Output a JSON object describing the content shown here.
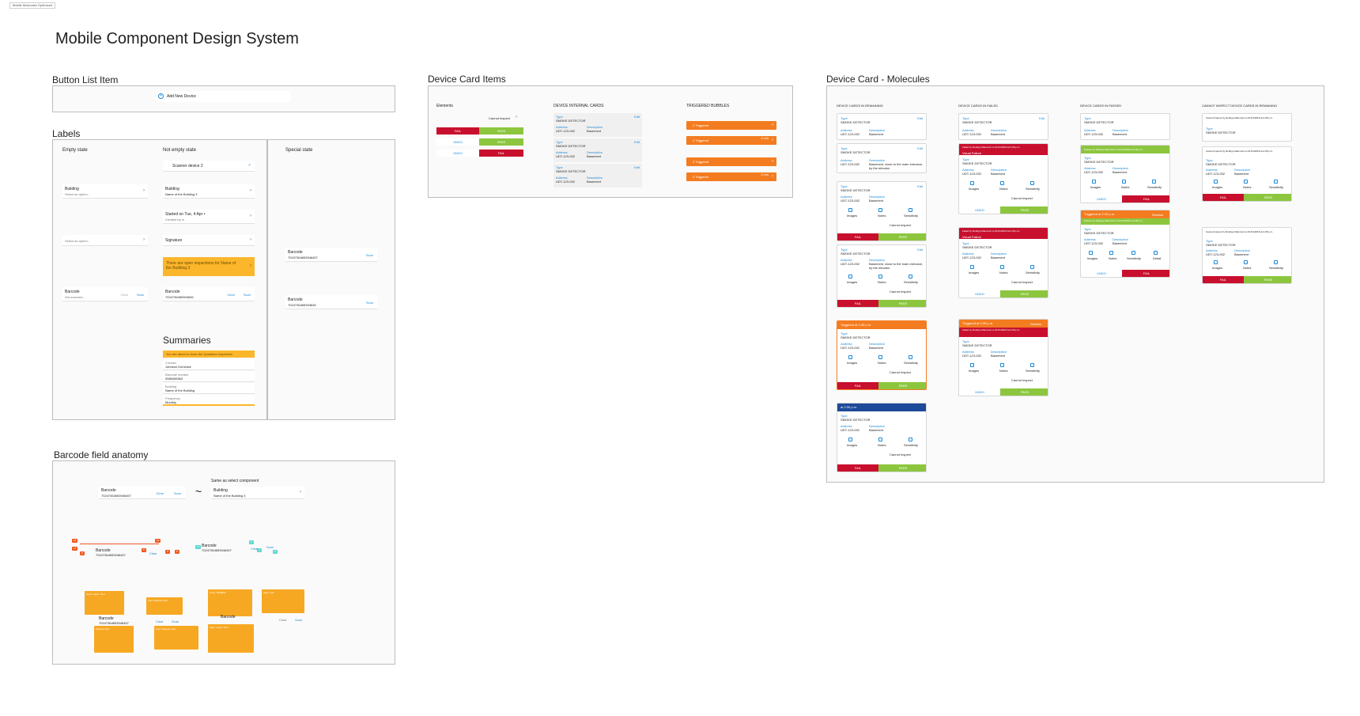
{
  "app": {
    "file_tab": "Mobile Molecules Optimized",
    "page_title": "Mobile Component Design System"
  },
  "sections": {
    "button_list_item": "Button List Item",
    "labels": "Labels",
    "barcode_anatomy": "Barcode field  anatomy",
    "device_card_items": "Device Card Items",
    "device_card_molecules": "Device Card - Molecules"
  },
  "button_list": {
    "add_device": "Add New Device"
  },
  "labels": {
    "empty_state": "Empty state",
    "not_empty_state": "Not empty state",
    "special_state": "Special state",
    "scanner_device": "Scanner device 2",
    "building": "Building",
    "select_an_option": "Select an option...",
    "building_value": "Name of the Building 3",
    "started_on": "Started on Tue, 4 Apr •",
    "started_sub": "Created by m",
    "signature": "Signature",
    "select_placeholder": "Select an option...",
    "warning": "There are open inspections for Name of the Building 3",
    "barcode": "Barcode",
    "barcode_placeholder": "Not scanned...",
    "barcode_value": "70247364653946457",
    "barcode_value_alt": "7024736465394645",
    "clear": "Clear",
    "scan": "Scan",
    "summaries_title": "Summaries",
    "summaries_banner": "You are about to close the Quotation Inspection",
    "summary_rows": [
      {
        "label": "Contact",
        "value": "Johnson Dominick"
      },
      {
        "label": "Barcode number",
        "value": "0586456563"
      },
      {
        "label": "Building",
        "value": "Name of the Building"
      },
      {
        "label": "Frequency",
        "value": "Monthly"
      }
    ]
  },
  "barcode_anatomy": {
    "barcode": "Barcode",
    "barcode_value": "70247364653946457",
    "clear": "Clear",
    "scan": "Scan",
    "tilde": "~",
    "same_as": "Same as select component",
    "building": "Building",
    "building_value": "Name of the Building 3",
    "note_lines": [
      "Style: Label / Text",
      "Font: Regular 12px",
      "Color: #000000",
      "Align: Left",
      "Spacing: 8px"
    ]
  },
  "device_items": {
    "elements": "Elements",
    "internal_cards": "DEVICE INTERNAL CARDS",
    "triggered_bubbles": "TRIGGERED BUBBLES",
    "cannot_inspect": "Cannot Inspect",
    "fail": "FAIL",
    "pass": "PASS",
    "undo": "UNDO",
    "type": "Type",
    "smoke_detector": "SMOKE DETECTOR",
    "address": "Address",
    "address_value": "UDT-123-002",
    "description": "Description",
    "description_value": "Basement",
    "edit": "Edit",
    "triggered": "2 Triggered",
    "triggered_time": "3 min"
  },
  "molecules": {
    "col_remaining": "DEVICE CARDS IN REMAINING",
    "col_failed": "DEVICE CARDS IN FAILED",
    "col_passed": "DEVICE CARDS IN PASSED",
    "col_cannot": "CANNOT INSPECT DEVICE CARDS IN REMAINING",
    "type": "Type",
    "smoke_detector": "SMOKE DETECTOR",
    "address": "Address",
    "address_value": "UDT-123-002",
    "description": "Description",
    "description_value": "Basement",
    "description_long": "Basement, close to the main entrance, by the elevator",
    "images": "Images",
    "notes": "Notes",
    "sensitivity": "Sensitivity",
    "detail": "Detail",
    "cannot_inspect": "Cannot Inspect",
    "fail": "FAIL",
    "pass": "PASS",
    "undo": "UNDO",
    "edit": "Edit",
    "triggered_at": "Triggered at 2:30 p.m.",
    "at_time": "at 2:30 p.m.",
    "failed_by": "Failed by Rodrigo Manzuoli on 01/31/2018 at 2:28 p.m.",
    "visual_failure": "Visual Failure",
    "passed_by": "Passed by Rodrigo Manzuoli on 01/31/2018 at 2:28 p.m.",
    "cannot_by": "Cannot Inspect by Rodrigo Manzuoli on 01/31/2018 at 2:28 p.m.",
    "dismiss": "Dismiss"
  }
}
